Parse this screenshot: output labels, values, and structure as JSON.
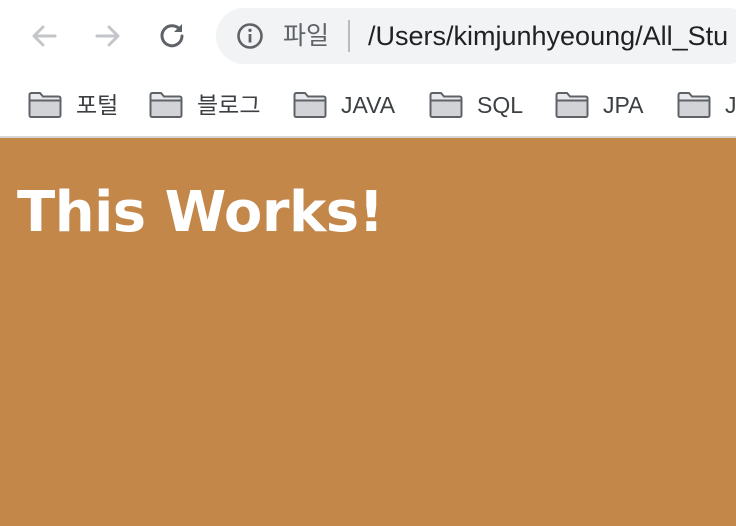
{
  "toolbar": {
    "back_icon": "arrow-left-icon",
    "forward_icon": "arrow-right-icon",
    "reload_icon": "reload-icon",
    "address": {
      "info_icon": "info-icon",
      "scheme_label": "파일",
      "url": "/Users/kimjunhyeoung/All_Stu"
    }
  },
  "bookmarks": {
    "items": [
      {
        "label": "포털",
        "icon": "folder-icon"
      },
      {
        "label": "블로그",
        "icon": "folder-icon"
      },
      {
        "label": "JAVA",
        "icon": "folder-icon"
      },
      {
        "label": "SQL",
        "icon": "folder-icon"
      },
      {
        "label": "JPA",
        "icon": "folder-icon"
      },
      {
        "label": "J",
        "icon": "folder-icon"
      }
    ]
  },
  "page": {
    "heading": "This Works!",
    "background_color": "#c4874a",
    "text_color": "#ffffff"
  }
}
